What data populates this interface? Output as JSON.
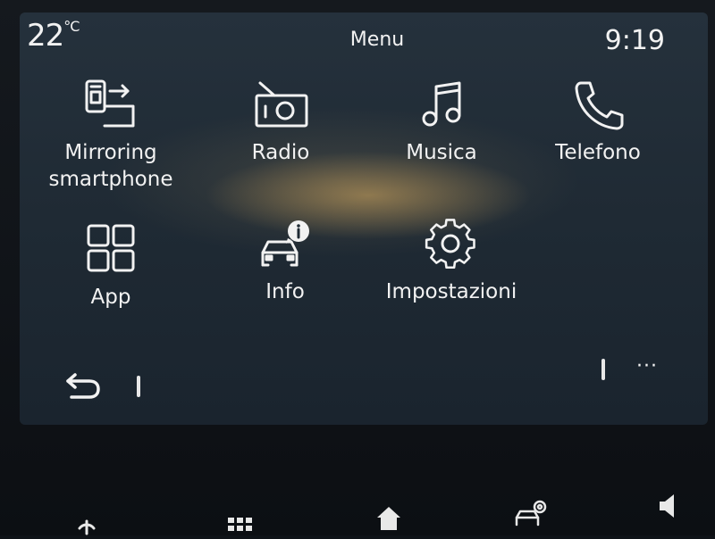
{
  "status": {
    "temperature": "22",
    "temperature_unit": "°C",
    "title": "Menu",
    "time": "9:19"
  },
  "menu": {
    "items": [
      {
        "label": "Mirroring\nsmartphone",
        "icon": "phone-mirroring-icon"
      },
      {
        "label": "Radio",
        "icon": "radio-icon"
      },
      {
        "label": "Musica",
        "icon": "music-note-icon"
      },
      {
        "label": "Telefono",
        "icon": "phone-handset-icon"
      },
      {
        "label": "App",
        "icon": "apps-grid-icon"
      },
      {
        "label": "Info",
        "icon": "car-info-icon"
      },
      {
        "label": "Impostazioni",
        "icon": "gear-icon"
      }
    ]
  },
  "bottom_bar": {
    "back_icon": "back-arrow-icon",
    "more_label": "···"
  },
  "hard_keys": {
    "icons": [
      "power-icon",
      "grid-icon",
      "home-icon",
      "car-settings-icon",
      "volume-icon"
    ]
  },
  "colors": {
    "icon": "#f2f2f2",
    "screen_bg": "#222d37",
    "glow": "#d6aa5f"
  }
}
